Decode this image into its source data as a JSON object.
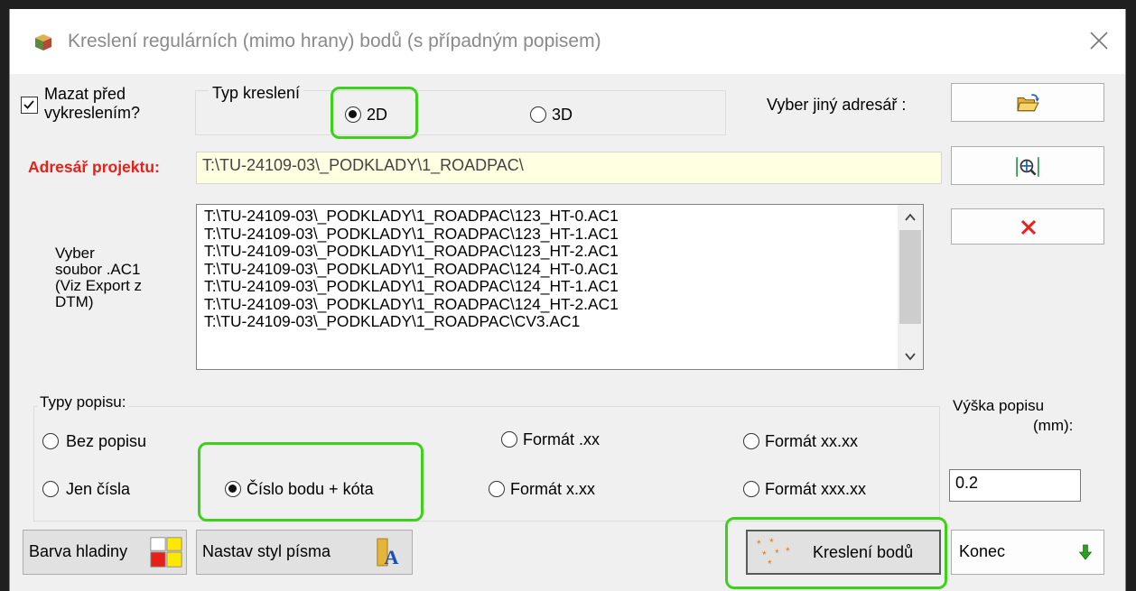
{
  "window": {
    "title": "Kreslení regulárních (mimo hrany)  bodů (s případným popisem)",
    "close_icon": "close-icon",
    "app_icon": "cube-icon"
  },
  "options": {
    "erase_label_line1": "Mazat před",
    "erase_label_line2": "vykreslením?",
    "erase_checked": true
  },
  "draw_type": {
    "group_label": "Typ kreslení",
    "options": [
      {
        "label": "2D",
        "checked": true
      },
      {
        "label": "3D",
        "checked": false
      }
    ]
  },
  "directory": {
    "choose_label": "Vyber jiný adresář :",
    "choose_icon": "open-folder-icon",
    "project_label": "Adresář projektu:",
    "project_value": "T:\\TU-24109-03\\_PODKLADY\\1_ROADPAC\\",
    "zoom_icon": "zoom-extents-icon",
    "delete_icon": "delete-x-icon"
  },
  "file_list": {
    "label_lines": [
      "Vyber",
      "soubor .AC1",
      "(Viz Export z",
      "DTM)"
    ],
    "items": [
      "T:\\TU-24109-03\\_PODKLADY\\1_ROADPAC\\123_HT-0.AC1",
      "T:\\TU-24109-03\\_PODKLADY\\1_ROADPAC\\123_HT-1.AC1",
      "T:\\TU-24109-03\\_PODKLADY\\1_ROADPAC\\123_HT-2.AC1",
      "T:\\TU-24109-03\\_PODKLADY\\1_ROADPAC\\124_HT-0.AC1",
      "T:\\TU-24109-03\\_PODKLADY\\1_ROADPAC\\124_HT-1.AC1",
      "T:\\TU-24109-03\\_PODKLADY\\1_ROADPAC\\124_HT-2.AC1",
      "T:\\TU-24109-03\\_PODKLADY\\1_ROADPAC\\CV3.AC1"
    ]
  },
  "label_types": {
    "group_label": "Typy popisu:",
    "options": [
      {
        "label": "Bez popisu",
        "checked": false
      },
      {
        "label": "Jen čísla",
        "checked": false
      },
      {
        "label": "Číslo bodu + kóta",
        "checked": true
      },
      {
        "label": "Formát .xx",
        "checked": false
      },
      {
        "label": "Formát x.xx",
        "checked": false
      },
      {
        "label": "Formát xx.xx",
        "checked": false
      },
      {
        "label": "Formát xxx.xx",
        "checked": false
      }
    ]
  },
  "text_height": {
    "label_line1": "Výška popisu",
    "label_line2": "(mm):",
    "value": "0.2"
  },
  "buttons": {
    "layer_color": "Barva hladiny",
    "font_style": "Nastav styl písma",
    "draw_points": "Kreslení bodů",
    "end": "Konec"
  },
  "colors": {
    "accent_red": "#e8201a",
    "highlight_green": "#3dd21a",
    "project_field_bg": "#ffffe1"
  }
}
